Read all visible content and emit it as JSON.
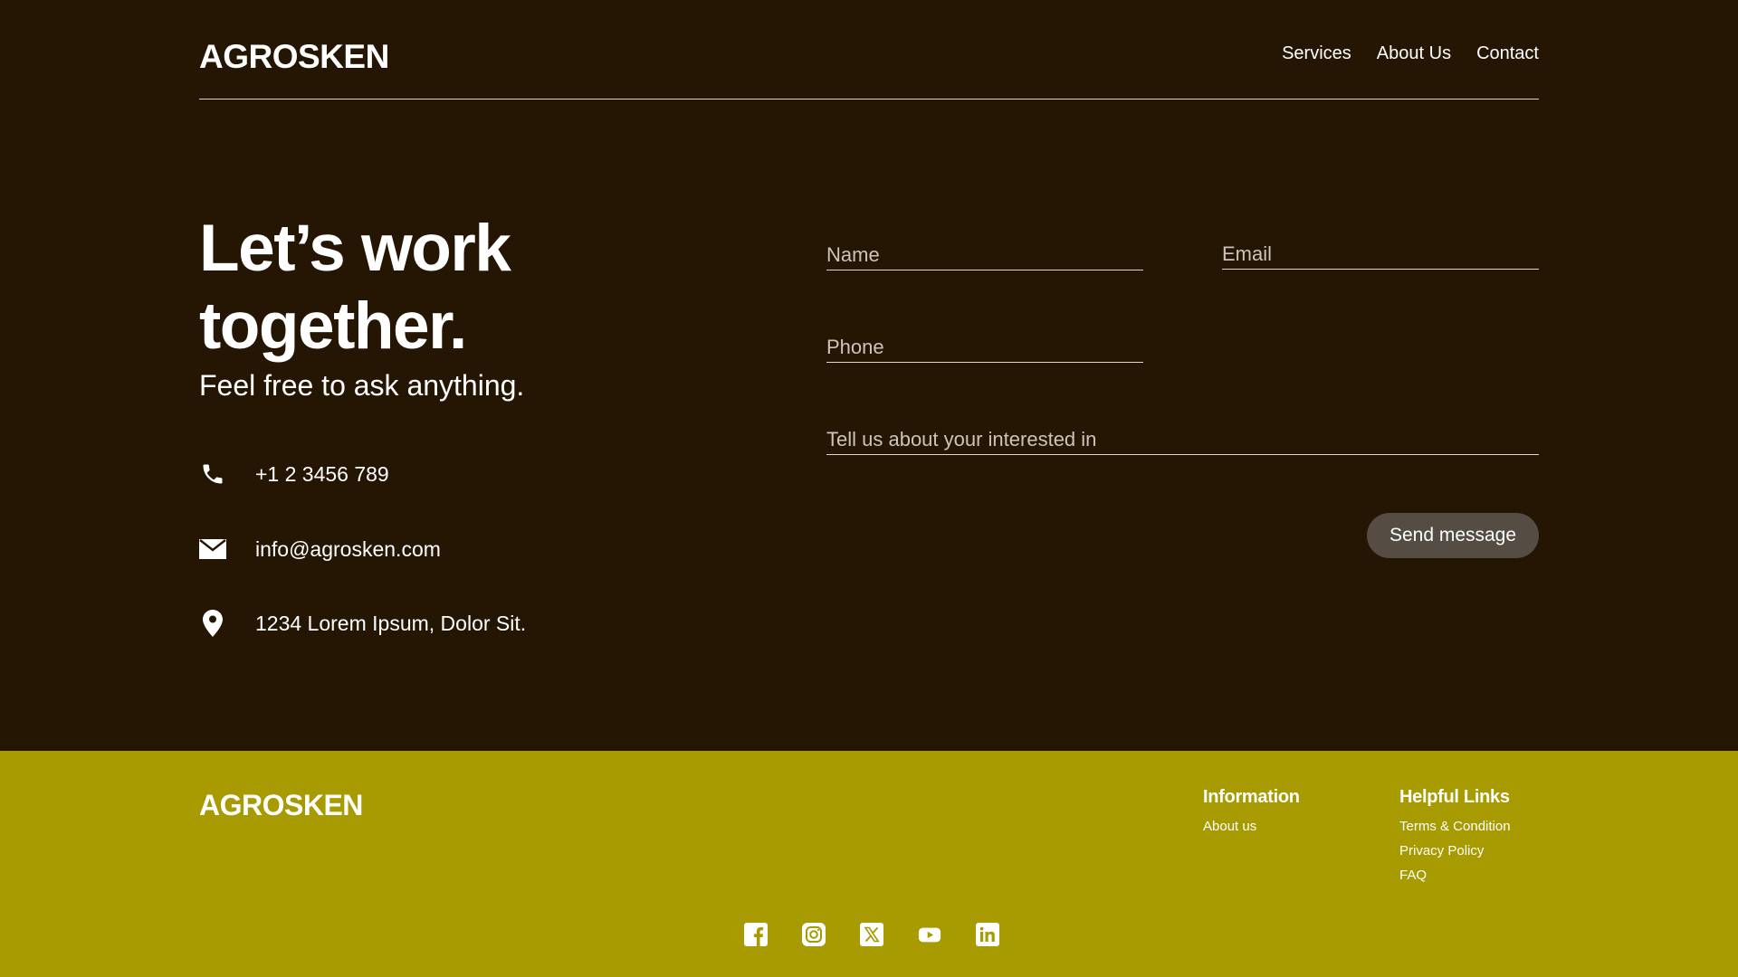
{
  "header": {
    "logo": "AGROSKEN",
    "nav": [
      "Services",
      "About Us",
      "Contact"
    ]
  },
  "hero": {
    "title_line1": "Let’s work",
    "title_line2": "together.",
    "subtitle": "Feel free to ask anything."
  },
  "contact": {
    "phone": "+1 2 3456 789",
    "email": "info@agrosken.com",
    "address": "1234 Lorem Ipsum, Dolor Sit."
  },
  "form": {
    "name_placeholder": "Name",
    "email_placeholder": "Email",
    "phone_placeholder": "Phone",
    "interest_placeholder": "Tell us about your interested in",
    "send_label": "Send message"
  },
  "footer": {
    "logo": "AGROSKEN",
    "information": {
      "heading": "Information",
      "links": [
        "About us"
      ]
    },
    "helpful": {
      "heading": "Helpful Links",
      "links": [
        "Terms & Condition",
        "Privacy Policy",
        "FAQ"
      ]
    },
    "socials": [
      "facebook-icon",
      "instagram-icon",
      "x-icon",
      "youtube-icon",
      "linkedin-icon"
    ]
  },
  "colors": {
    "background": "#251503",
    "footer": "#a79b01",
    "button": "#554c43"
  }
}
